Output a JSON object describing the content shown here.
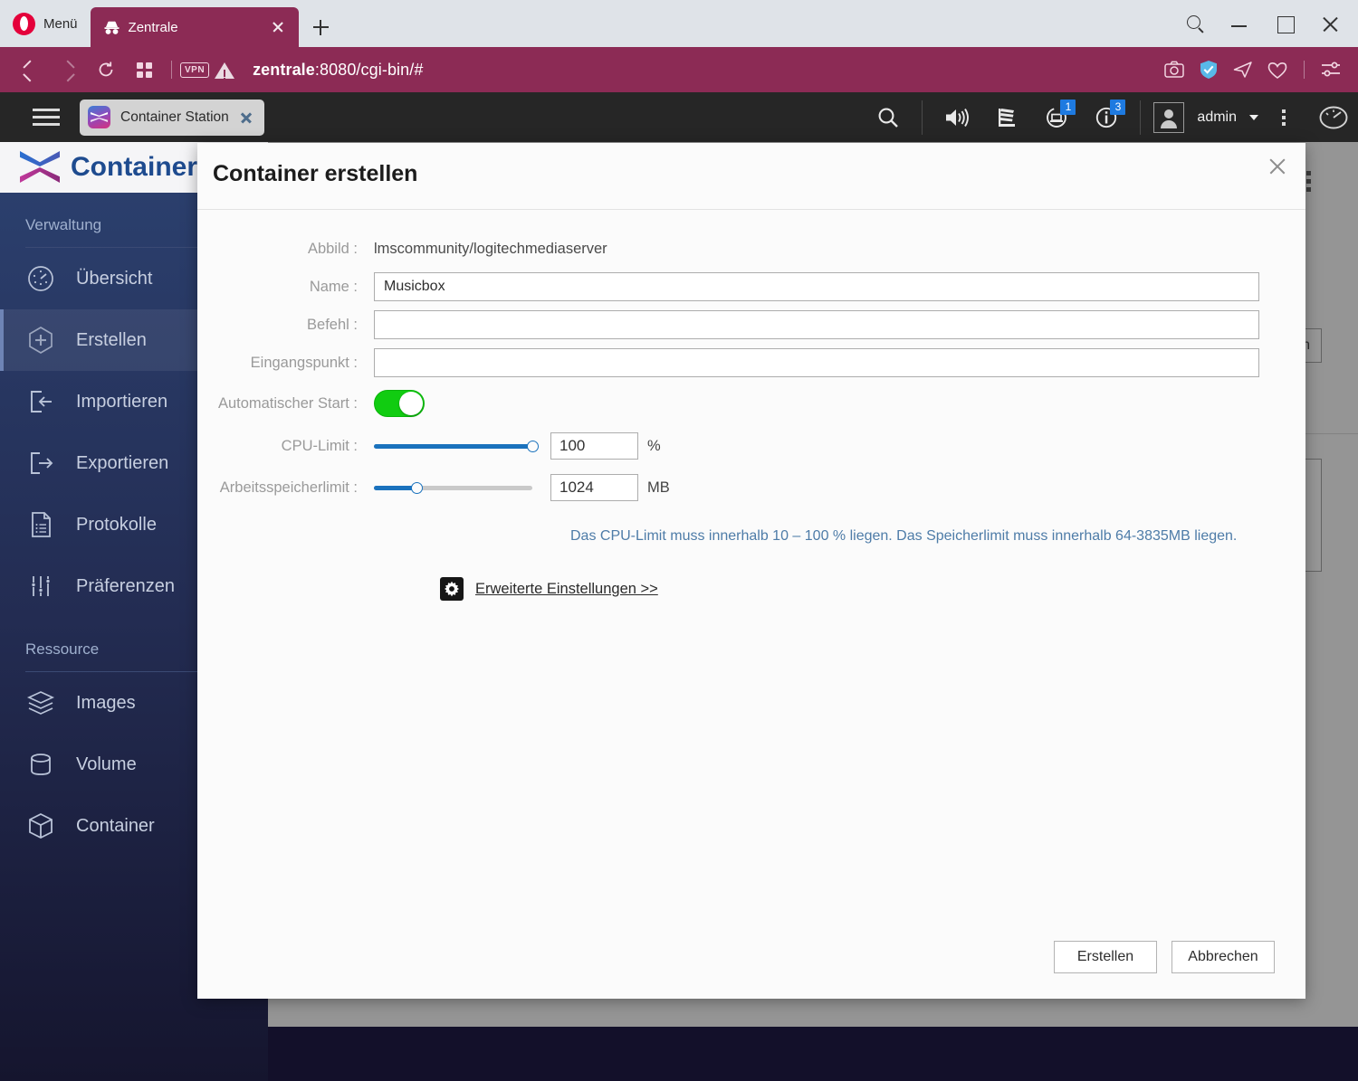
{
  "browser": {
    "menu_label": "Menü",
    "tab": {
      "title": "Zentrale",
      "favicon": "incognito-hat-icon"
    },
    "new_tab_icon": "plus-icon",
    "window_controls": [
      "search-icon",
      "minimize-icon",
      "maximize-icon",
      "close-icon"
    ],
    "nav": {
      "back": "back-arrow-icon",
      "forward": "forward-arrow-icon",
      "reload": "reload-icon",
      "tabs_overview": "grid-icon",
      "vpn_badge": "VPN",
      "security_warning": "warning-triangle-icon",
      "url": "zentrale:8080/cgi-bin/#",
      "url_host": "zentrale",
      "url_path": ":8080/cgi-bin/#"
    },
    "address_icons": [
      "snapshot-camera-icon",
      "ad-block-shield-icon",
      "send-to-device-icon",
      "heart-icon",
      "easy-setup-icon"
    ]
  },
  "qts": {
    "menu_icon": "hamburger-menu-icon",
    "app_tab": {
      "label": "Container Station",
      "icon": "container-station-icon",
      "close_icon": "close-icon"
    },
    "toolbar_icons": [
      {
        "name": "search-icon",
        "badge": null
      },
      {
        "name": "volume-icon",
        "badge": null
      },
      {
        "name": "background-tasks-icon",
        "badge": null
      },
      {
        "name": "external-device-icon",
        "badge": "1"
      },
      {
        "name": "notification-info-icon",
        "badge": "3"
      }
    ],
    "user": {
      "name": "admin",
      "avatar_icon": "user-avatar-icon",
      "caret": "chevron-down-icon"
    },
    "more_icon": "kebab-menu-icon",
    "dashboard_icon": "dashboard-gauge-icon"
  },
  "app": {
    "logo_text": "ContainerStation",
    "logo_icon": "container-station-logo",
    "sidebar": [
      {
        "type": "section",
        "label": "Verwaltung"
      },
      {
        "type": "item",
        "label": "Übersicht",
        "icon": "overview-gauge-icon",
        "active": false
      },
      {
        "type": "item",
        "label": "Erstellen",
        "icon": "create-plus-icon",
        "active": true
      },
      {
        "type": "item",
        "label": "Importieren",
        "icon": "import-icon",
        "active": false
      },
      {
        "type": "item",
        "label": "Exportieren",
        "icon": "export-icon",
        "active": false
      },
      {
        "type": "item",
        "label": "Protokolle",
        "icon": "logs-document-icon",
        "active": false
      },
      {
        "type": "item",
        "label": "Präferenzen",
        "icon": "preferences-sliders-icon",
        "active": false
      },
      {
        "type": "section",
        "label": "Ressource"
      },
      {
        "type": "item",
        "label": "Images",
        "icon": "images-layers-icon",
        "active": false
      },
      {
        "type": "item",
        "label": "Volume",
        "icon": "volume-cylinder-icon",
        "active": false
      },
      {
        "type": "item",
        "label": "Container",
        "icon": "container-cube-icon",
        "active": false
      }
    ],
    "background": {
      "partial_button_label": "en",
      "kebab_icon": "kebab-menu-icon"
    }
  },
  "dialog": {
    "title": "Container erstellen",
    "close_icon": "close-icon",
    "fields": {
      "image": {
        "label": "Abbild :",
        "value": "lmscommunity/logitechmediaserver"
      },
      "name": {
        "label": "Name :",
        "value": "Musicbox",
        "placeholder": ""
      },
      "command": {
        "label": "Befehl :",
        "value": "",
        "placeholder": ""
      },
      "entrypoint": {
        "label": "Eingangspunkt :",
        "value": "",
        "placeholder": ""
      },
      "autostart": {
        "label": "Automatischer Start :",
        "enabled": true,
        "color": "#11cc11"
      },
      "cpu_limit": {
        "label": "CPU-Limit :",
        "value": "100",
        "unit": "%",
        "percent": 100,
        "min": 10,
        "max": 100
      },
      "memory_limit": {
        "label": "Arbeitsspeicherlimit :",
        "value": "1024",
        "unit": "MB",
        "percent": 27,
        "min": 64,
        "max": 3835
      }
    },
    "hint": "Das CPU-Limit muss innerhalb 10 – 100 % liegen. Das Speicherlimit muss innerhalb 64-3835MB liegen.",
    "advanced": {
      "label": "Erweiterte Einstellungen >>",
      "icon": "gear-icon"
    },
    "buttons": {
      "create": "Erstellen",
      "cancel": "Abbrechen"
    }
  },
  "colors": {
    "opera_accent": "#8c2b55",
    "qts_topbar": "#262626",
    "sidebar_top": "#2b3f6d",
    "sidebar_bottom": "#15152e",
    "logo_blue": "#1e4b8f",
    "toggle_green": "#11cc11",
    "slider_blue": "#1a72bd",
    "hint_blue": "#4e7ca8",
    "badge_blue": "#1e7ae0"
  }
}
